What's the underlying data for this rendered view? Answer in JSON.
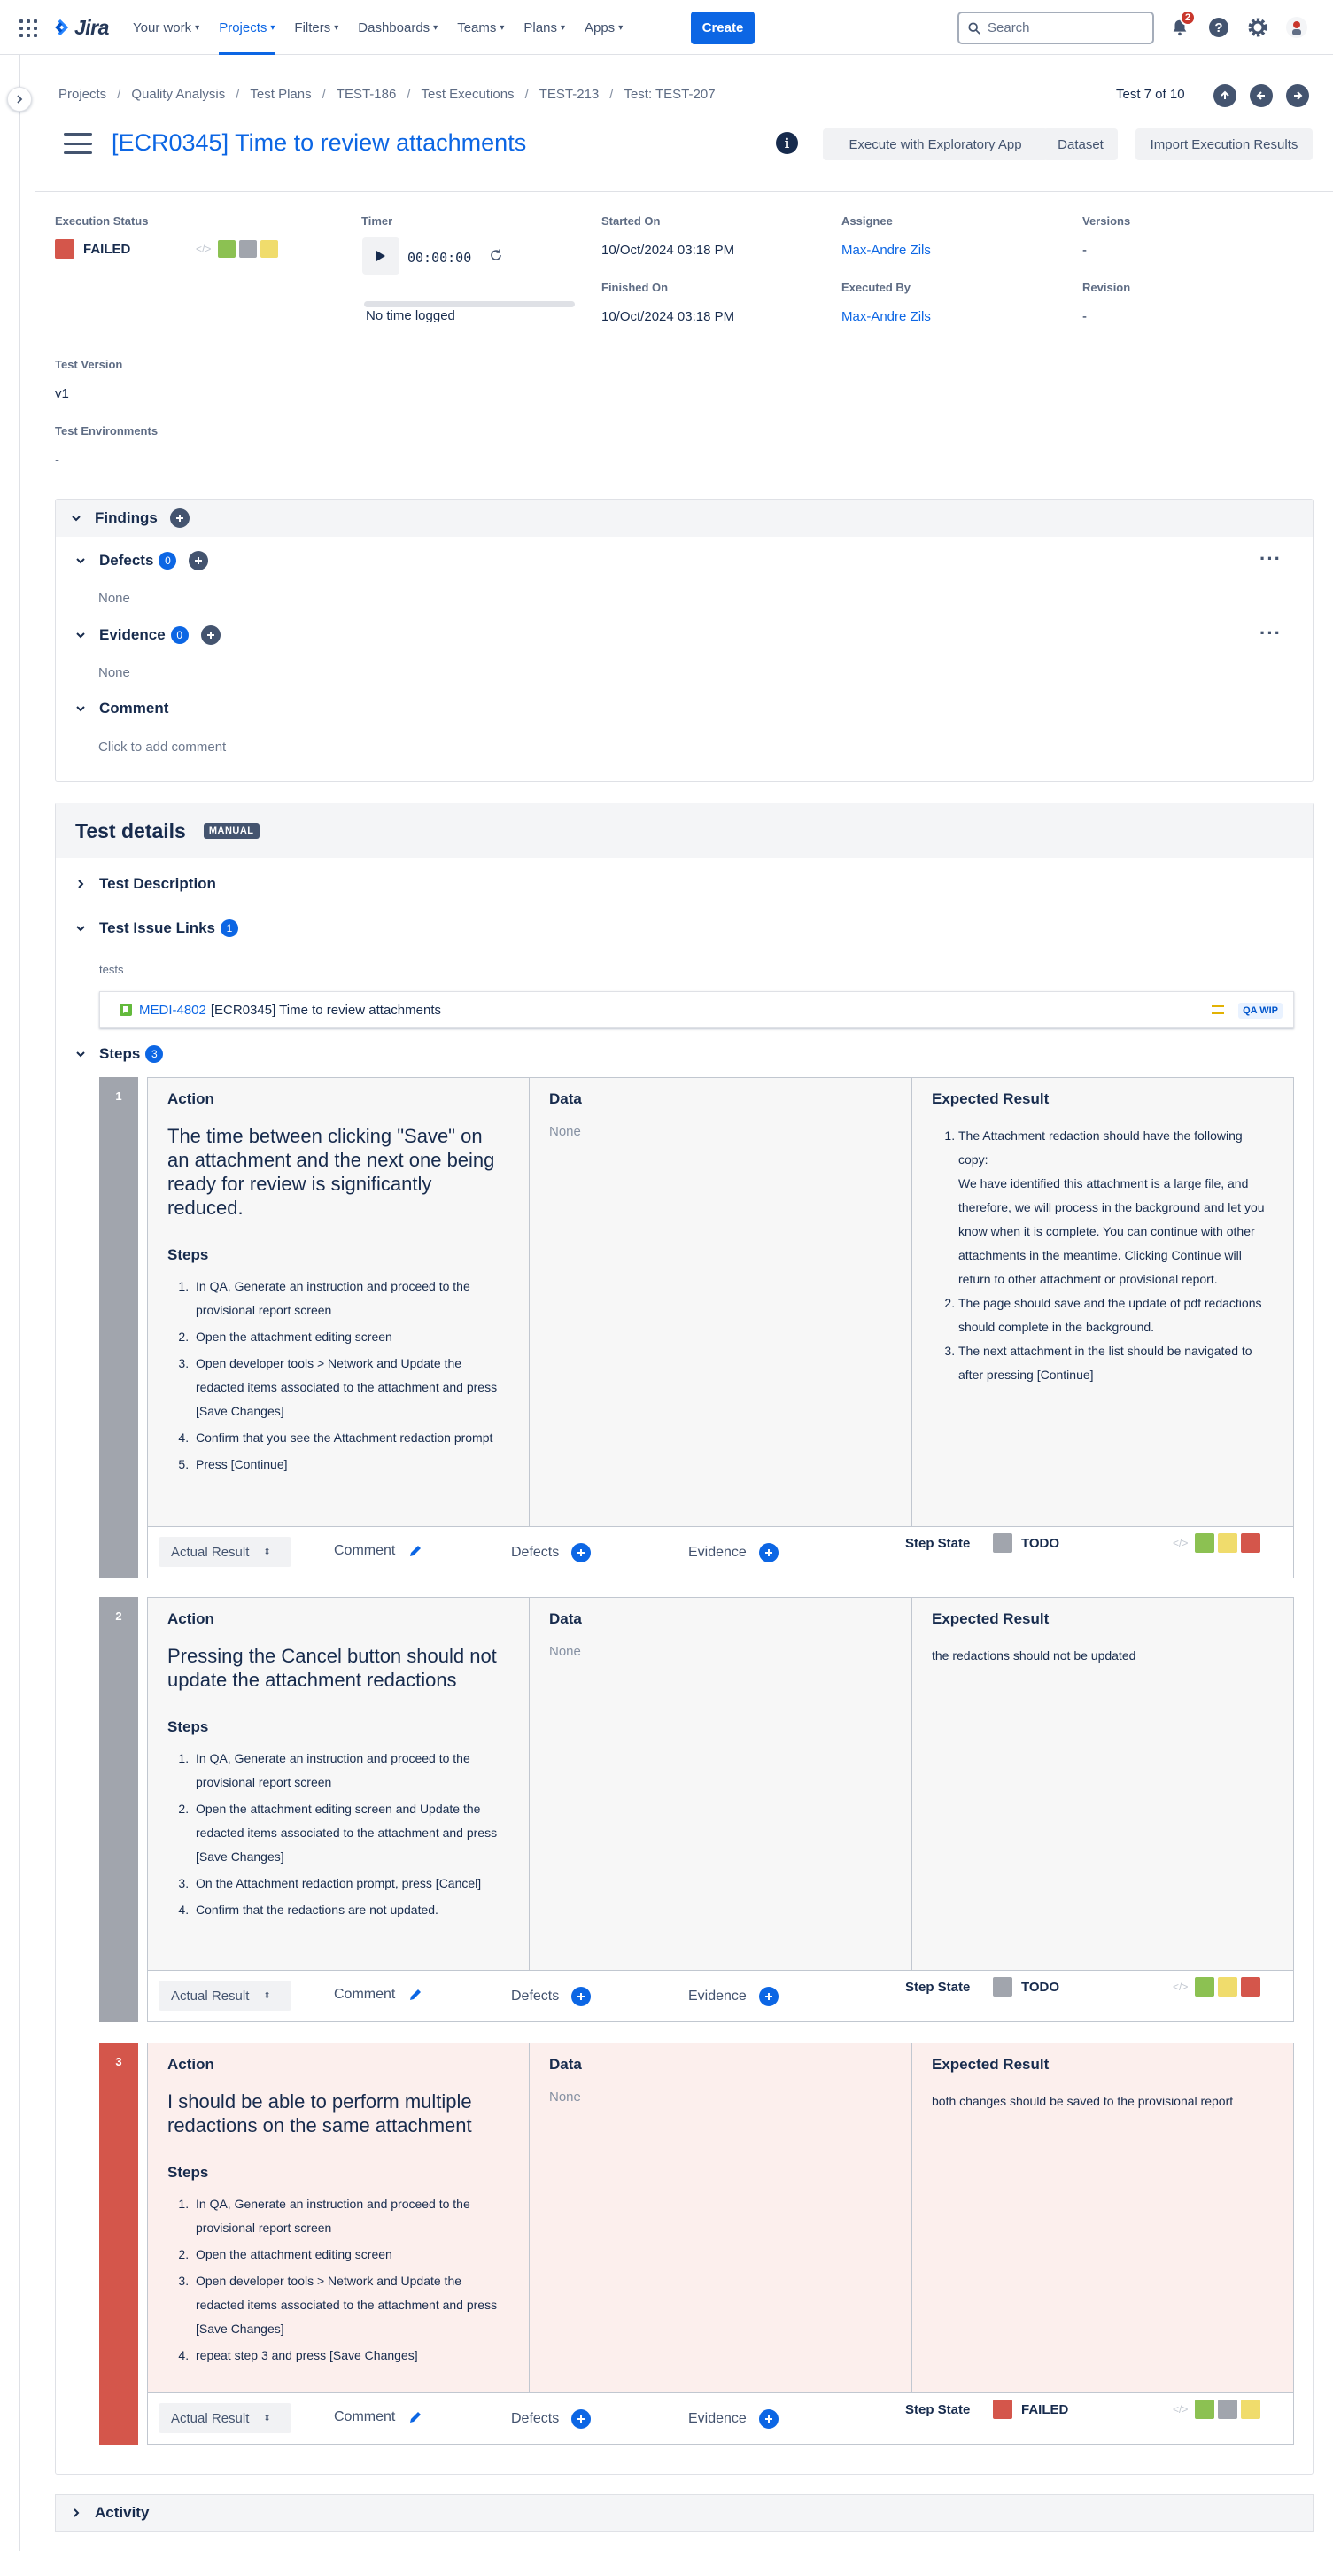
{
  "nav": {
    "logo": "Jira",
    "items": [
      {
        "label": "Your work",
        "active": false
      },
      {
        "label": "Projects",
        "active": true
      },
      {
        "label": "Filters",
        "active": false
      },
      {
        "label": "Dashboards",
        "active": false
      },
      {
        "label": "Teams",
        "active": false
      },
      {
        "label": "Plans",
        "active": false
      },
      {
        "label": "Apps",
        "active": false
      }
    ],
    "create": "Create",
    "search_placeholder": "Search",
    "notif_count": "2"
  },
  "breadcrumb": [
    "Projects",
    "Quality Analysis",
    "Test Plans",
    "TEST-186",
    "Test Executions",
    "TEST-213",
    "Test: TEST-207"
  ],
  "test_counter": "Test 7 of 10",
  "title": "[ECR0345] Time to review attachments",
  "header_buttons": {
    "exploratory": "Execute with Exploratory App",
    "dataset": "Dataset",
    "import": "Import Execution Results"
  },
  "fields": {
    "execution_status_label": "Execution Status",
    "execution_status": "FAILED",
    "timer_label": "Timer",
    "timer_value": "00:00:00",
    "no_time": "No time logged",
    "started_on_label": "Started On",
    "started_on": "10/Oct/2024 03:18 PM",
    "finished_on_label": "Finished On",
    "finished_on": "10/Oct/2024 03:18 PM",
    "assignee_label": "Assignee",
    "assignee": "Max-Andre Zils",
    "executed_by_label": "Executed By",
    "executed_by": "Max-Andre Zils",
    "versions_label": "Versions",
    "versions": "-",
    "revision_label": "Revision",
    "revision": "-",
    "test_version_label": "Test Version",
    "test_version": "v1",
    "test_env_label": "Test Environments",
    "test_env": "-"
  },
  "findings": {
    "title": "Findings",
    "defects_label": "Defects",
    "defects_count": "0",
    "defects_value": "None",
    "evidence_label": "Evidence",
    "evidence_count": "0",
    "evidence_value": "None",
    "comment_label": "Comment",
    "comment_placeholder": "Click to add comment"
  },
  "test_details": {
    "title": "Test details",
    "badge": "MANUAL",
    "description": "Test Description",
    "issue_links": "Test Issue Links",
    "issue_links_count": "1",
    "link_type": "tests",
    "link_key": "MEDI-4802",
    "link_summary": "[ECR0345] Time to review attachments",
    "link_status": "QA WIP",
    "steps_label": "Steps",
    "steps_count": "3"
  },
  "step_common": {
    "action": "Action",
    "data": "Data",
    "expected": "Expected Result",
    "steps_heading": "Steps",
    "none": "None",
    "actual_result": "Actual Result",
    "comment": "Comment",
    "defects": "Defects",
    "evidence": "Evidence",
    "step_state": "Step State"
  },
  "steps": [
    {
      "num": "1",
      "title": "The time between clicking \"Save\" on an attachment and the next one being ready for review is significantly reduced.",
      "items": [
        "In QA, Generate an instruction and proceed to the provisional report screen",
        "Open the attachment editing screen",
        "Open developer tools > Network and Update the redacted items associated to the attachment and press [Save Changes]",
        "Confirm that you see the Attachment redaction prompt",
        "Press [Continue]"
      ],
      "expected": [
        "The Attachment redaction should have the following copy:",
        "We have identified this attachment is a large file, and therefore, we will process in the background and let you know when it is complete. You can continue with other attachments in the meantime. Clicking Continue will return to other attachment or provisional report.",
        "The page should save and the update of pdf redactions should complete in the background.",
        "The next attachment in the list should be navigated to after pressing [Continue]"
      ],
      "state": "TODO",
      "state_color": "#a1a5ad"
    },
    {
      "num": "2",
      "title": "Pressing the Cancel button should not update the attachment redactions",
      "items": [
        "In QA, Generate an instruction and proceed to the provisional report screen",
        "Open the attachment editing screen and  Update the redacted items associated to the attachment and press [Save Changes]",
        "On the Attachment redaction prompt, press [Cancel]",
        "Confirm that the redactions are not updated."
      ],
      "expected_text": "the redactions should not be updated",
      "state": "TODO",
      "state_color": "#a1a5ad"
    },
    {
      "num": "3",
      "title": "I should be able to perform multiple redactions on the same attachment",
      "items": [
        "In QA, Generate an instruction and proceed to the provisional report screen",
        "Open the attachment editing screen",
        "Open developer tools > Network and Update the redacted items associated to the attachment and press [Save Changes]",
        "repeat step 3 and press [Save Changes]"
      ],
      "expected_text": "both changes should be saved to the provisional report",
      "state": "FAILED",
      "state_color": "#d4564b"
    }
  ],
  "activity": "Activity",
  "colors": {
    "failed": "#d4564b",
    "passed": "#8cc152",
    "todo": "#a1a5ad",
    "executing": "#f0dc6c",
    "accent": "#0c66e4"
  }
}
